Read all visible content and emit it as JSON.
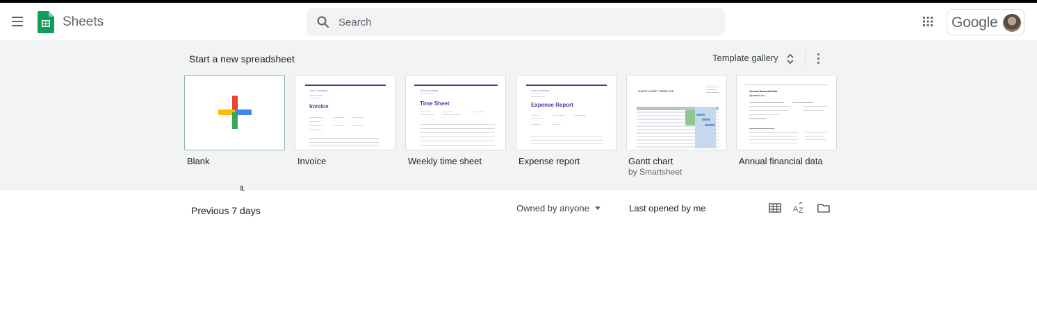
{
  "header": {
    "app_title": "Sheets",
    "search_placeholder": "Search",
    "account_label": "Google",
    "icons": [
      "menu-icon",
      "sheets-logo-icon",
      "search-icon",
      "apps-grid-icon",
      "avatar"
    ]
  },
  "templates": {
    "section_title": "Start a new spreadsheet",
    "gallery_label": "Template gallery",
    "items": [
      {
        "label": "Blank",
        "subtitle": ""
      },
      {
        "label": "Invoice",
        "subtitle": "",
        "preview_title": "Invoice",
        "preview_company": "Your Company"
      },
      {
        "label": "Weekly time sheet",
        "subtitle": "",
        "preview_title": "Time Sheet",
        "preview_company": "Your Company"
      },
      {
        "label": "Expense report",
        "subtitle": "",
        "preview_title": "Expense Report",
        "preview_company": "Your Company"
      },
      {
        "label": "Gantt chart",
        "subtitle": "by Smartsheet",
        "preview_title": "GANTT CHART TEMPLATE"
      },
      {
        "label": "Annual financial data",
        "subtitle": "",
        "preview_title": "Annual financial data",
        "preview_company": "Alphabet Inc."
      }
    ]
  },
  "list": {
    "section_title": "Previous 7 days",
    "owner_filter": "Owned by anyone",
    "sort_label": "Last opened by me",
    "view_icons": [
      "grid-view-icon",
      "sort-az-icon",
      "folder-icon"
    ]
  },
  "colors": {
    "sheets_green": "#0f9d58",
    "background_gray": "#f1f3f4",
    "plus_red": "#ea4335",
    "plus_blue": "#4285f4",
    "plus_yellow": "#fbbc04",
    "plus_green": "#34a853"
  }
}
